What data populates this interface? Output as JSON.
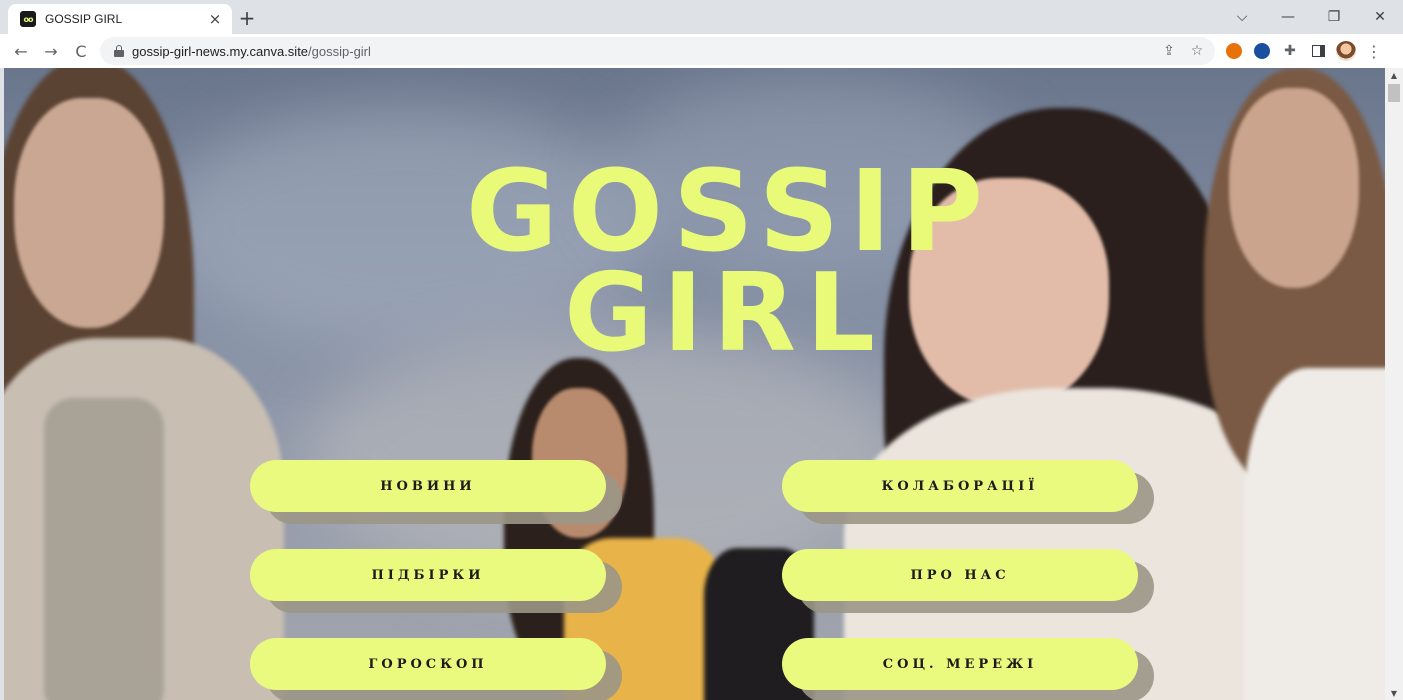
{
  "browser": {
    "tab": {
      "title": "GOSSIP GIRL",
      "favicon_text": "oo",
      "close_glyph": "×"
    },
    "new_tab_glyph": "+",
    "window_controls": {
      "list_tabs": "⌵",
      "minimize": "—",
      "restore": "❐",
      "close": "✕"
    },
    "nav": {
      "back": "←",
      "forward": "→",
      "reload": "C"
    },
    "url": {
      "host": "gossip-girl-news.my.canva.site",
      "path": "/gossip-girl"
    },
    "omnibox_icons": {
      "share": "⇪",
      "bookmark": "☆"
    },
    "extensions": [
      {
        "name": "extension-fire",
        "color": "#e8710a"
      },
      {
        "name": "extension-blue",
        "color": "#1a4fa0"
      }
    ],
    "menu_glyph": "⋮",
    "puzzle_glyph": "✚"
  },
  "page": {
    "title_line1": "GOSSIP",
    "title_line2": "GIRL",
    "accent_color": "#e9fa78",
    "menu": {
      "news": "НОВИНИ",
      "collabs": "КОЛАБОРАЦІЇ",
      "selections": "ПІДБІРКИ",
      "about": "ПРО НАС",
      "horoscope": "ГОРОСКОП",
      "social": "СОЦ. МЕРЕЖІ"
    }
  },
  "scrollbar": {
    "up": "▲",
    "down": "▼"
  }
}
